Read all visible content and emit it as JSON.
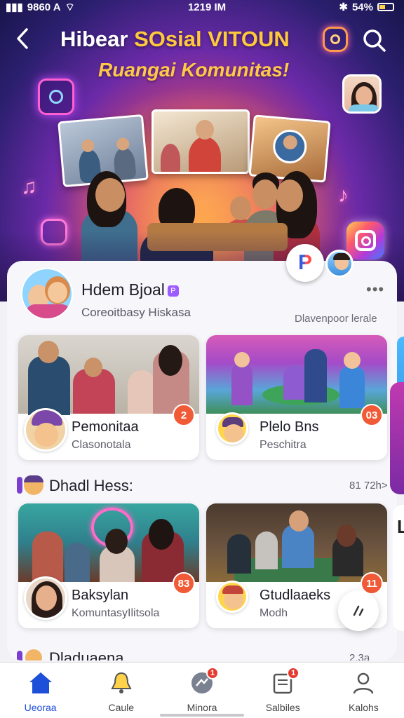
{
  "status": {
    "left": "9860 A",
    "time": "1219 IM",
    "battery": "54%"
  },
  "header": {
    "title_part1": "Hibear ",
    "title_part2": "SOsial VITOUN",
    "subtitle": "Ruangai Komunitas!"
  },
  "profile": {
    "name": "Hdem Bjoal",
    "verified_mark": "P",
    "subtitle": "Coreoitbasy Hiskasa",
    "discover_label": "Dlavenpoor lerale",
    "more": "•••"
  },
  "cards_top": [
    {
      "title": "Pemonitaa",
      "subtitle": "Clasonotala",
      "badge": "2"
    },
    {
      "title": "Plelo Bns",
      "subtitle": "Peschitra",
      "badge": "03"
    }
  ],
  "section": {
    "title": "Dhadl Hess:",
    "more": "81 72h>"
  },
  "cards_bottom": [
    {
      "title": "Baksylan",
      "subtitle": "KomuntasyIlitsola",
      "badge": "83"
    },
    {
      "title": "Gtudlaaeks",
      "subtitle": "Modh",
      "badge": "11"
    }
  ],
  "section2": {
    "title": "Dladuaena",
    "more": "2.3a"
  },
  "peek_text": "L",
  "p_badge": "P",
  "nav": [
    {
      "label": "Ueoraa",
      "icon": "home-icon"
    },
    {
      "label": "Caule",
      "icon": "bell-icon"
    },
    {
      "label": "Minora",
      "icon": "chat-icon",
      "badge": "1"
    },
    {
      "label": "Salbiles",
      "icon": "inbox-icon",
      "badge": "1"
    },
    {
      "label": "Kalohs",
      "icon": "profile-icon"
    }
  ],
  "colors": {
    "accent": "#1d4fd8",
    "badge": "#f05a36",
    "title_accent": "#ffc93c"
  }
}
